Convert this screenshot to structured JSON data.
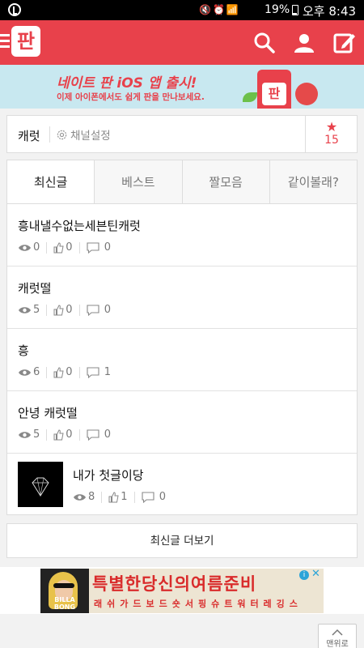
{
  "status_bar": {
    "battery_percent": "19%",
    "time": "오후 8:43"
  },
  "header": {
    "logo_text": "판",
    "icons": [
      "menu-icon",
      "search-icon",
      "user-icon",
      "write-icon"
    ]
  },
  "promo_banner": {
    "title": "네이트 판 iOS 앱 출시!",
    "subtitle": "이제 아이폰에서도 쉽게 판을 만나보세요.",
    "logo_text": "판"
  },
  "channel": {
    "name": "캐럿",
    "settings_label": "채널설정",
    "star_count": "15"
  },
  "tabs": [
    {
      "label": "최신글",
      "active": true
    },
    {
      "label": "베스트",
      "active": false
    },
    {
      "label": "짤모음",
      "active": false
    },
    {
      "label": "같이볼래?",
      "active": false
    }
  ],
  "posts": [
    {
      "title": "흥내낼수없는세븐틴캐럿",
      "views": "0",
      "likes": "0",
      "comments": "0",
      "has_thumbnail": false
    },
    {
      "title": "캐럿떨",
      "views": "5",
      "likes": "0",
      "comments": "0",
      "has_thumbnail": false
    },
    {
      "title": "흥",
      "views": "6",
      "likes": "0",
      "comments": "1",
      "has_thumbnail": false
    },
    {
      "title": "안녕 캐럿떨",
      "views": "5",
      "likes": "0",
      "comments": "0",
      "has_thumbnail": false
    },
    {
      "title": "내가 첫글이당",
      "views": "8",
      "likes": "1",
      "comments": "0",
      "has_thumbnail": true
    }
  ],
  "more_button": {
    "label": "최신글 더보기"
  },
  "ad": {
    "title": "특별한당신의여름준비",
    "subtitle": "래쉬가드보드숏서핑슈트워터레깅스",
    "brand": "BILLA BONG"
  },
  "top_button": {
    "label": "맨위로"
  },
  "colors": {
    "brand": "#e8414b",
    "banner_bg": "#c8e8f0"
  }
}
